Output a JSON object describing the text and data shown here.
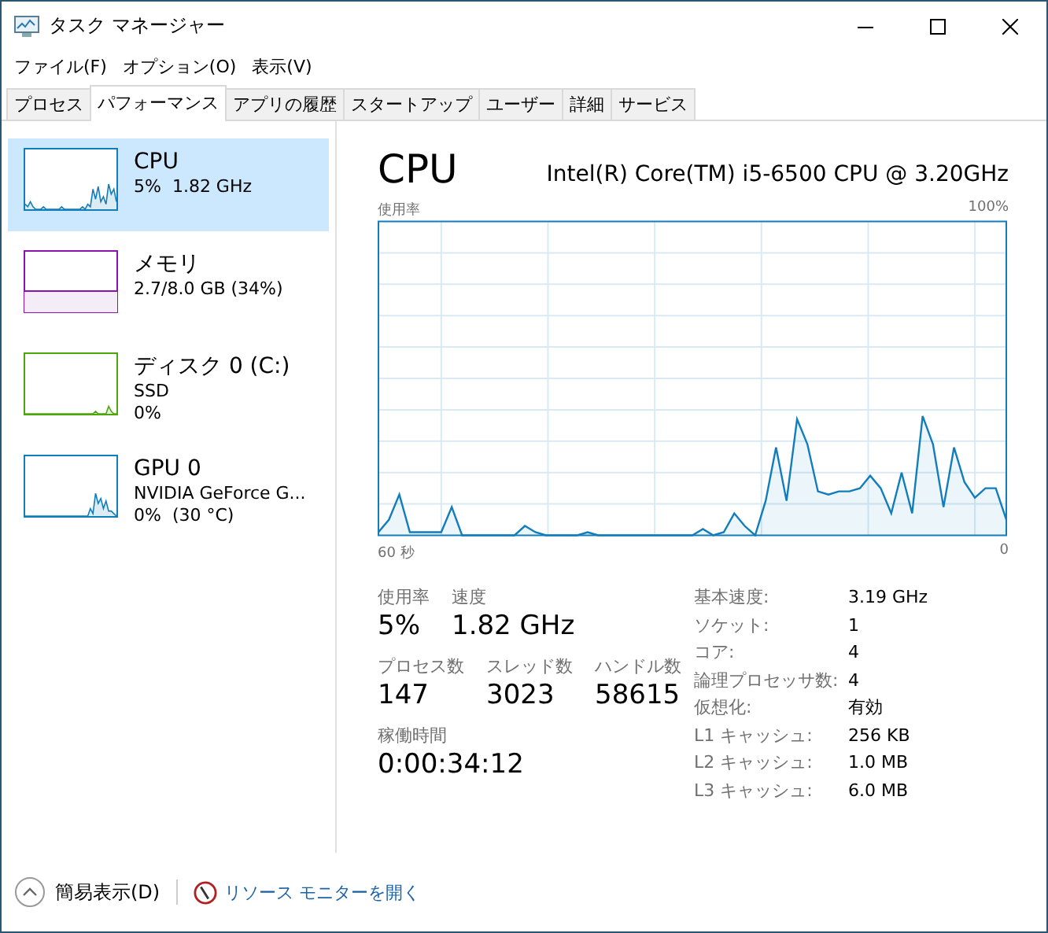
{
  "window": {
    "title": "タスク マネージャー"
  },
  "menu": [
    {
      "label": "ファイル(F)"
    },
    {
      "label": "オプション(O)"
    },
    {
      "label": "表示(V)"
    }
  ],
  "tabs": [
    {
      "label": "プロセス",
      "selected": false
    },
    {
      "label": "パフォーマンス",
      "selected": true
    },
    {
      "label": "アプリの履歴",
      "selected": false
    },
    {
      "label": "スタートアップ",
      "selected": false
    },
    {
      "label": "ユーザー",
      "selected": false
    },
    {
      "label": "詳細",
      "selected": false
    },
    {
      "label": "サービス",
      "selected": false
    }
  ],
  "sidebar": {
    "items": [
      {
        "name": "CPU",
        "lines": [
          "5%  1.82 GHz"
        ],
        "color": "#117dbb",
        "kind": "line",
        "selected": true
      },
      {
        "name": "メモリ",
        "lines": [
          "2.7/8.0 GB (34%)"
        ],
        "color": "#8b12ae",
        "kind": "bar",
        "selected": false
      },
      {
        "name": "ディスク 0 (C:)",
        "lines": [
          "SSD",
          "0%"
        ],
        "color": "#4da60c",
        "kind": "line",
        "selected": false
      },
      {
        "name": "GPU 0",
        "lines": [
          "NVIDIA GeForce G...",
          "0%  (30 °C)"
        ],
        "color": "#117dbb",
        "kind": "line",
        "selected": false
      }
    ]
  },
  "detail": {
    "title": "CPU",
    "model": "Intel(R) Core(TM) i5-6500 CPU @ 3.20GHz",
    "graph": {
      "label": "使用率",
      "max_label": "100%",
      "start_label": "60 秒",
      "end_label": "0"
    },
    "stats": [
      [
        {
          "label": "使用率",
          "value": "5%"
        },
        {
          "label": "速度",
          "value": "1.82 GHz"
        }
      ],
      [
        {
          "label": "プロセス数",
          "value": "147"
        },
        {
          "label": "スレッド数",
          "value": "3023"
        },
        {
          "label": "ハンドル数",
          "value": "58615"
        }
      ],
      [
        {
          "label": "稼働時間",
          "value": "0:00:34:12"
        }
      ]
    ],
    "specs": [
      {
        "label": "基本速度:",
        "value": "3.19 GHz"
      },
      {
        "label": "ソケット:",
        "value": "1"
      },
      {
        "label": "コア:",
        "value": "4"
      },
      {
        "label": "論理プロセッサ数:",
        "value": "4"
      },
      {
        "label": "仮想化:",
        "value": "有効"
      },
      {
        "label": "L1 キャッシュ:",
        "value": "256 KB"
      },
      {
        "label": "L2 キャッシュ:",
        "value": "1.0 MB"
      },
      {
        "label": "L3 キャッシュ:",
        "value": "6.0 MB"
      }
    ]
  },
  "footer": {
    "fewer_details": "簡易表示(D)",
    "resource_monitor": "リソース モニターを開く"
  }
}
